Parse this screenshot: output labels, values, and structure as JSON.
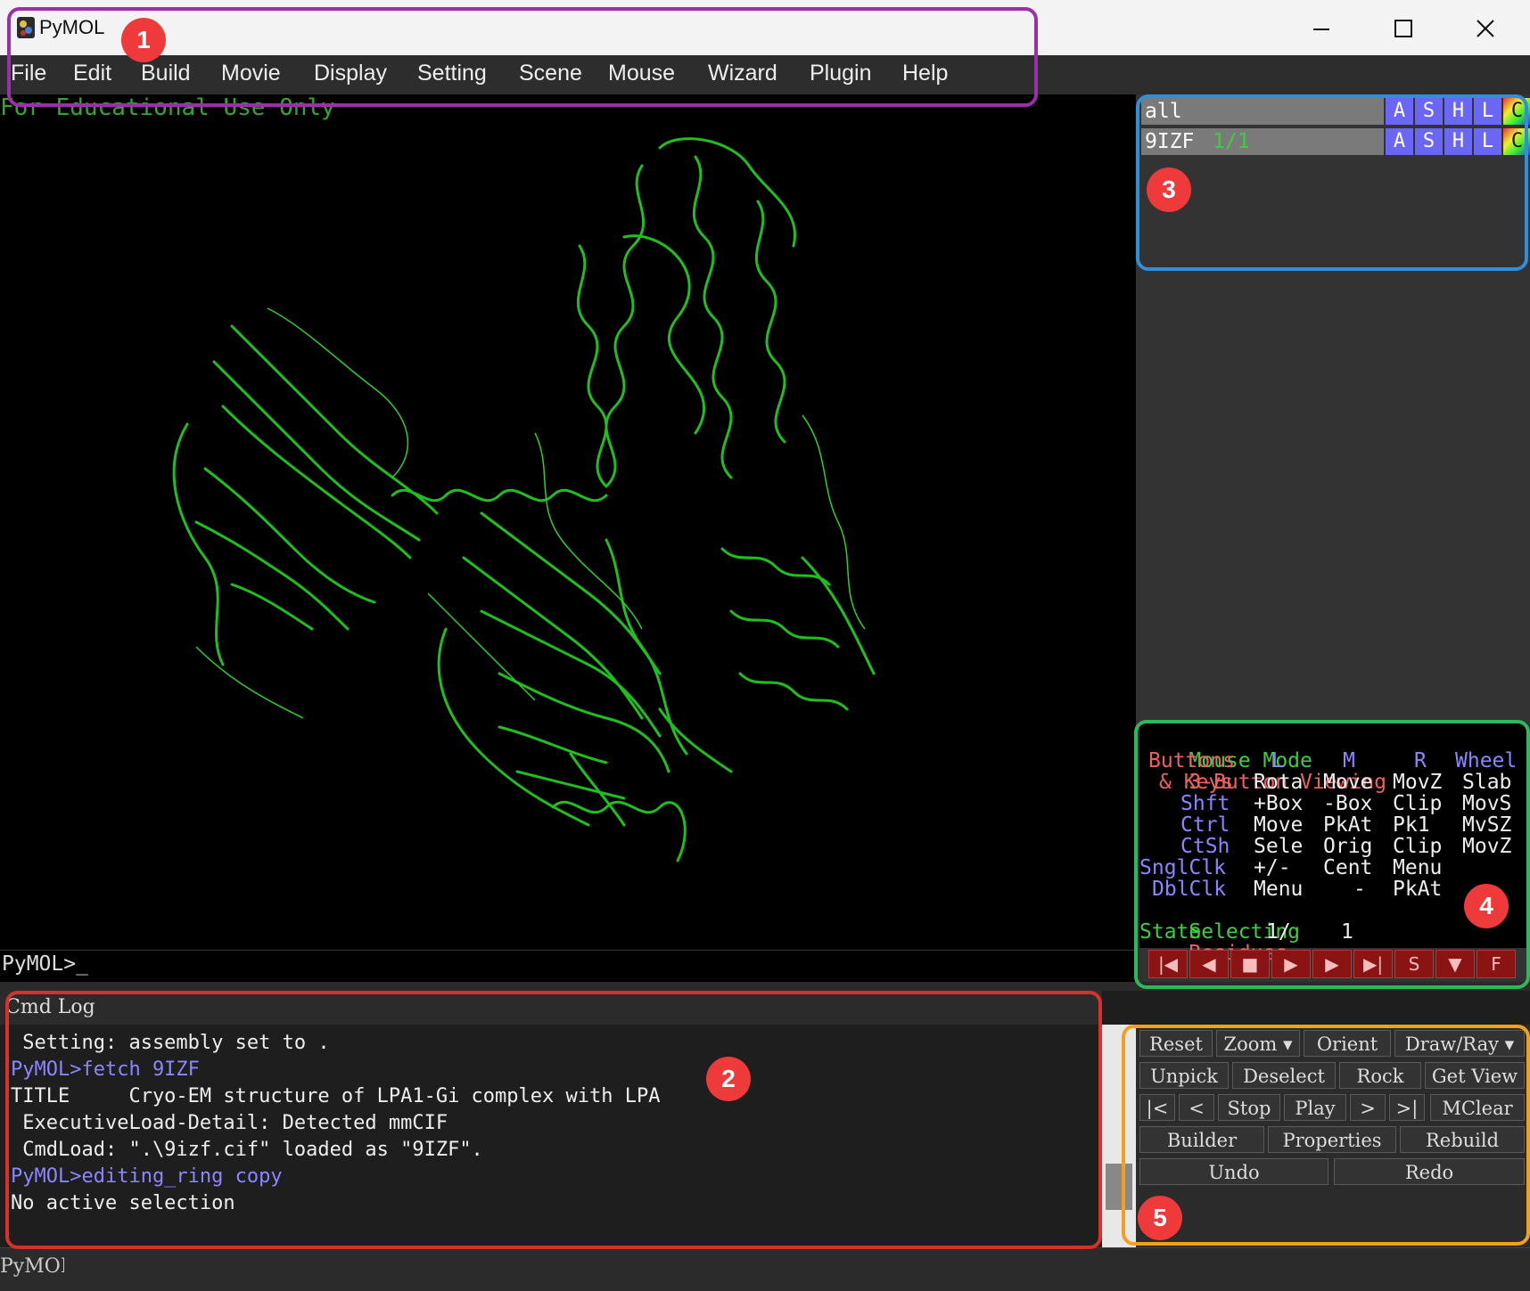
{
  "window": {
    "title": "PyMOL",
    "controls": [
      "minimize-icon",
      "maximize-icon",
      "close-icon"
    ]
  },
  "menubar": {
    "items": [
      "File",
      "Edit",
      "Build",
      "Movie",
      "Display",
      "Setting",
      "Scene",
      "Mouse",
      "Wizard",
      "Plugin",
      "Help"
    ]
  },
  "viewport": {
    "overlay_text": "For Educational Use Only",
    "prompt": "PyMOL>_",
    "molecule_color": "#22cc22"
  },
  "objects": {
    "rows": [
      {
        "name": "all",
        "state": ""
      },
      {
        "name": "9IZF",
        "state": "1/1"
      }
    ],
    "buttons": [
      "A",
      "S",
      "H",
      "L",
      "C"
    ]
  },
  "mouse_mode": {
    "title_label": "Mouse Mode",
    "title_value": "3-Button Viewing",
    "header": {
      "label": "Buttons",
      "cols": [
        "L",
        "M",
        "R",
        "Wheel"
      ]
    },
    "rows": [
      {
        "key": "& Keys",
        "vals": [
          "Rota",
          "Move",
          "MovZ",
          "Slab"
        ]
      },
      {
        "key": "Shft",
        "vals": [
          "+Box",
          "-Box",
          "Clip",
          "MovS"
        ]
      },
      {
        "key": "Ctrl",
        "vals": [
          "Move",
          "PkAt",
          "Pk1",
          "MvSZ"
        ]
      },
      {
        "key": "CtSh",
        "vals": [
          "Sele",
          "Orig",
          "Clip",
          "MovZ"
        ]
      },
      {
        "key": "SnglClk",
        "vals": [
          "+/-",
          "Cent",
          "Menu",
          ""
        ]
      },
      {
        "key": "DblClk",
        "vals": [
          "Menu",
          "-",
          "PkAt",
          ""
        ]
      }
    ],
    "selecting_label": "Selecting",
    "selecting_value": "Residues",
    "state_label": "State",
    "state_current": "1/",
    "state_total": "1"
  },
  "playbar": {
    "buttons": [
      {
        "glyph": "|◀",
        "name": "first-frame-button"
      },
      {
        "glyph": "◀",
        "name": "prev-frame-button"
      },
      {
        "glyph": "■",
        "name": "stop-button"
      },
      {
        "glyph": "▶",
        "name": "play-button"
      },
      {
        "glyph": "▶",
        "name": "next-frame-button"
      },
      {
        "glyph": "▶|",
        "name": "last-frame-button"
      },
      {
        "glyph": "S",
        "name": "scene-button"
      },
      {
        "glyph": "▼",
        "name": "menu-down-button"
      },
      {
        "glyph": "F",
        "name": "fullscreen-button"
      }
    ]
  },
  "cmdlog": {
    "tab_label": "Cmd Log",
    "lines": [
      {
        "text": " Setting: assembly set to .",
        "kind": "normal"
      },
      {
        "text": "PyMOL>fetch 9IZF",
        "kind": "cmd"
      },
      {
        "text": "TITLE     Cryo-EM structure of LPA1-Gi complex with LPA",
        "kind": "normal"
      },
      {
        "text": " ExecutiveLoad-Detail: Detected mmCIF",
        "kind": "normal"
      },
      {
        "text": " CmdLoad: \".\\9izf.cif\" loaded as \"9IZF\".",
        "kind": "normal"
      },
      {
        "text": "PyMOL>editing_ring copy",
        "kind": "cmd"
      },
      {
        "text": "No active selection",
        "kind": "normal"
      }
    ]
  },
  "button_panel": {
    "row1": [
      "Reset",
      "Zoom ▾",
      "Orient",
      "Draw/Ray ▾"
    ],
    "row2": [
      "Unpick",
      "Deselect",
      "Rock",
      "Get View"
    ],
    "row3": [
      "|<",
      "<",
      "Stop",
      "Play",
      ">",
      ">|",
      "MClear"
    ],
    "row4": [
      "Builder",
      "Properties",
      "Rebuild"
    ],
    "row5": [
      "Undo",
      "Redo"
    ]
  },
  "bottom": {
    "prompt": "PyMOL>"
  },
  "annotations": [
    {
      "label": "1",
      "color": "#9b2fa8"
    },
    {
      "label": "2",
      "color": "#d9302a"
    },
    {
      "label": "3",
      "color": "#2f8fd9"
    },
    {
      "label": "4",
      "color": "#2fb85a"
    },
    {
      "label": "5",
      "color": "#f0a020"
    }
  ]
}
